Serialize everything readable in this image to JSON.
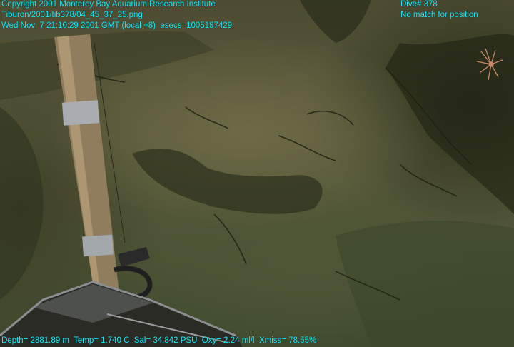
{
  "overlay": {
    "copyright": "Copyright 2001 Monterey Bay Aquarium Research Institute",
    "file_path": "Tiburon/2001/tib378/04_45_37_25.png",
    "timestamp": "Wed Nov  7 21:10:29 2001 GMT (local +8)  esecs=1005187429",
    "dive": "Dive# 378",
    "position_status": "No match for position",
    "telemetry": "Depth= 2881.89 m  Temp= 1.740 C  Sal= 34.842 PSU  Oxy= 2.24 ml/l  Xmiss= 78.55%"
  },
  "colors": {
    "overlay_text": "#17e6f2",
    "seafloor": "#5a5a3b",
    "shadow": "#262a18"
  }
}
